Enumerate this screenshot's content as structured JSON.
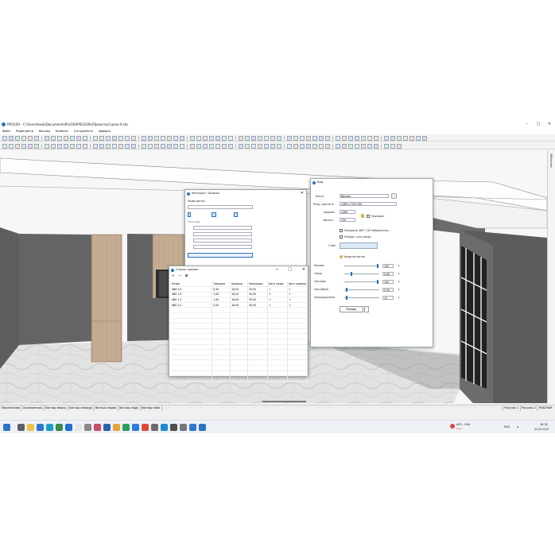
{
  "app": {
    "title": "PRO100 - C:\\Users\\lexlo\\Documents\\Pro100\\PRO100x\\Проекты\\Сцена 6.sto",
    "minimize": "–",
    "maximize": "□",
    "close": "✕"
  },
  "menu": [
    "Файл",
    "Редагувати",
    "Вигляд",
    "Елемент",
    "Інструменти",
    "Довідка"
  ],
  "right_panel_label": "Бібліотека",
  "bottom_tabs": [
    "Перспектива",
    "Аксонометрія",
    "Вигляд зверху",
    "Вигляд спереду",
    "Вигляд справа",
    "Вигляд ззаду",
    "Вигляд зліва"
  ],
  "page_tabs": [
    "Рисунок 1",
    "Рисунок 2",
    "РОБОЧАЯ"
  ],
  "edge_dialog": {
    "title": "Матеріал / Кромка",
    "section_label": "Назва деталі",
    "texture_label": "Текстура"
  },
  "edges_list": {
    "title": "Список кромок",
    "toolbar": [
      "+",
      "−",
      "⊞"
    ],
    "minimize": "—",
    "maximize": "□",
    "close": "✕",
    "columns": [
      "Назва",
      "Товщина",
      "Ширина",
      "Надлишок",
      "Авто назва",
      "Авто ширина"
    ],
    "rows": [
      {
        "name": "ABS 0,5",
        "thickness": "0,50",
        "width": "18,00",
        "excess": "30,00",
        "auto_name": "+",
        "auto_width": "+"
      },
      {
        "name": "ABS 1,0",
        "thickness": "1,00",
        "width": "18,00",
        "excess": "30,00",
        "auto_name": "+",
        "auto_width": "+"
      },
      {
        "name": "ABS 1,5",
        "thickness": "1,50",
        "width": "18,00",
        "excess": "30,00",
        "auto_name": "+",
        "auto_width": "+"
      },
      {
        "name": "ABS 2,0",
        "thickness": "2,00",
        "width": "18,00",
        "excess": "30,00",
        "auto_name": "+",
        "auto_width": "+"
      }
    ]
  },
  "view_dialog": {
    "title": "Вид",
    "quality_label": "Якість",
    "quality_value": "Висока",
    "resolution_label": "Розд. здатність",
    "resolution_value": "1280 x 720 (HD)",
    "width_label": "Ширина",
    "width_value": "1280",
    "height_label": "Висота",
    "height_value": "720",
    "proportional_label": "Пропорції",
    "panorama_label": "Панорама 360° | 3D Зображення...",
    "camera_label": "Рендер з усіх камер",
    "styles_label": "Стилі",
    "shadows_label": "Кидання світла",
    "sliders": [
      {
        "label": "Фонове",
        "value": "100",
        "level": 0.98
      },
      {
        "label": "Сонце",
        "value": "0,60",
        "level": 0.2
      },
      {
        "label": "Світлове",
        "value": "100",
        "level": 0.98
      },
      {
        "label": "Світлобумі",
        "value": "0,55",
        "level": 0.05
      },
      {
        "label": "Знешкодження",
        "value": "15",
        "level": 0.05
      }
    ],
    "render_button": "Рендер"
  },
  "taskbar": {
    "weather_temp": "АРО - РАК",
    "weather_sub": "Live",
    "lang": "ENG",
    "time": "18:35",
    "date": "02.09.2025"
  },
  "colors": {
    "floor": "#dcdcdc",
    "wall": "#5e5f61",
    "cabinet": "#c2aa92",
    "accent": "#2a6fbf"
  }
}
